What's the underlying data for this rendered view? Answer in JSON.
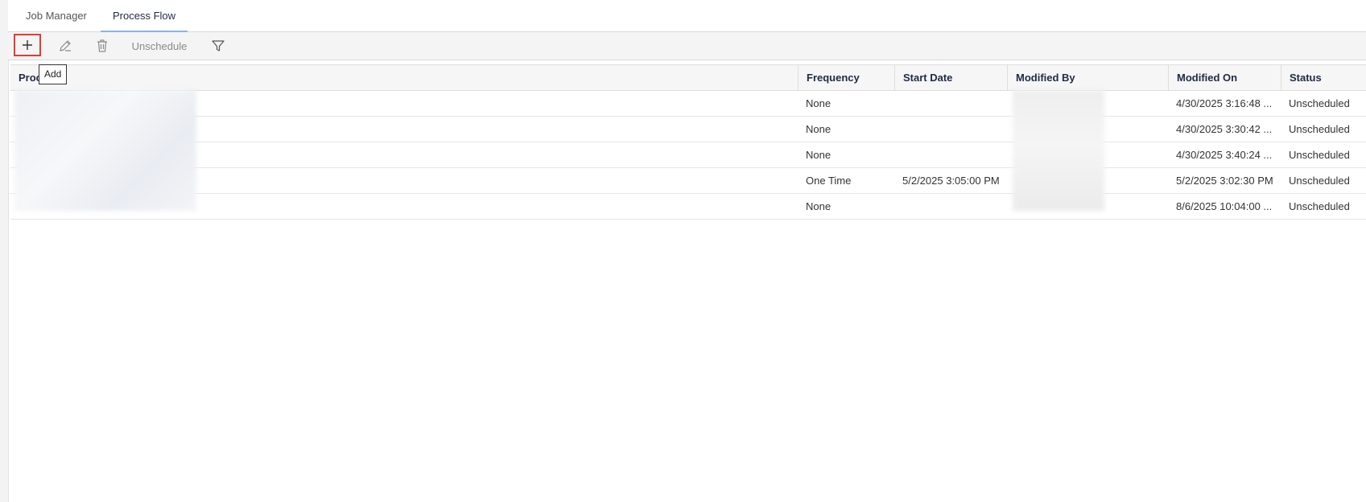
{
  "tabs": [
    {
      "label": "Job Manager",
      "active": false
    },
    {
      "label": "Process Flow",
      "active": true
    }
  ],
  "toolbar": {
    "add_icon": "plus-icon",
    "edit_icon": "pencil-icon",
    "delete_icon": "trash-icon",
    "unschedule_label": "Unschedule",
    "filter_icon": "filter-icon"
  },
  "tooltip": {
    "text": "Add"
  },
  "table": {
    "columns": [
      "Proc",
      "Frequency",
      "Start Date",
      "Modified By",
      "Modified On",
      "Status"
    ],
    "rows": [
      {
        "frequency": "None",
        "start_date": "",
        "modified_on": "4/30/2025 3:16:48 ...",
        "status": "Unscheduled"
      },
      {
        "frequency": "None",
        "start_date": "",
        "modified_on": "4/30/2025 3:30:42 ...",
        "status": "Unscheduled"
      },
      {
        "frequency": "None",
        "start_date": "",
        "modified_on": "4/30/2025 3:40:24 ...",
        "status": "Unscheduled"
      },
      {
        "frequency": "One Time",
        "start_date": "5/2/2025 3:05:00 PM",
        "modified_on": "5/2/2025 3:02:30 PM",
        "status": "Unscheduled"
      },
      {
        "frequency": "None",
        "start_date": "",
        "modified_on": "8/6/2025 10:04:00 ...",
        "status": "Unscheduled"
      }
    ]
  },
  "colors": {
    "highlight": "#e53935",
    "active_tab_underline": "#8fb1e8",
    "header_text": "#1f2a44"
  }
}
